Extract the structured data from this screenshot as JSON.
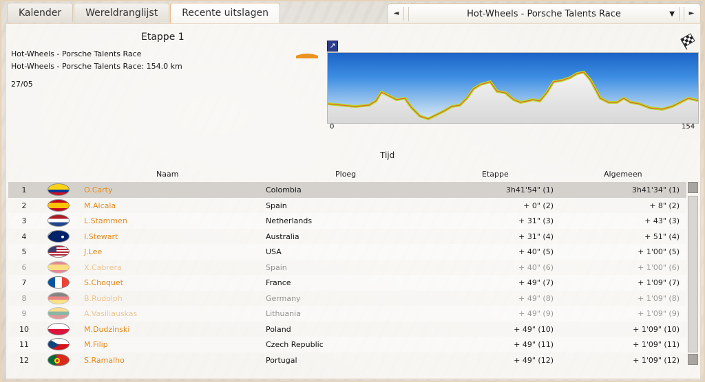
{
  "tabs": [
    {
      "label": "Kalender"
    },
    {
      "label": "Wereldranglijst"
    },
    {
      "label": "Recente uitslagen"
    }
  ],
  "race_selector": {
    "selected": "Hot-Wheels - Porsche Talents Race",
    "prev_icon": "triangle-left-icon",
    "next_icon": "triangle-right-icon",
    "dropdown_icon": "caret-down-icon"
  },
  "stage": {
    "title": "Etappe 1",
    "race_name": "Hot-Wheels - Porsche Talents Race",
    "race_distance": "Hot-Wheels - Porsche Talents Race: 154.0 km",
    "date": "27/05",
    "profile_start_km": "0",
    "profile_end_km": "154"
  },
  "section_label": "Tijd",
  "columns": {
    "name": "Naam",
    "team": "Ploeg",
    "stage": "Etappe",
    "general": "Algemeen"
  },
  "colors": {
    "accent": "#e38a1c",
    "profile_sky_top": "#1b63c6",
    "profile_ground": "#e6e6e6"
  },
  "results": [
    {
      "pos": "1",
      "flag": "colombia",
      "name": "O.Carty",
      "team": "Colombia",
      "stage": "3h41'54\" (1)",
      "general": "3h41'34\" (1)"
    },
    {
      "pos": "2",
      "flag": "spain",
      "name": "M.Alcala",
      "team": "Spain",
      "stage": "+ 0\" (2)",
      "general": "+ 8\" (2)"
    },
    {
      "pos": "3",
      "flag": "netherlands",
      "name": "L.Stammen",
      "team": "Netherlands",
      "stage": "+ 31\" (3)",
      "general": "+ 43\" (3)"
    },
    {
      "pos": "4",
      "flag": "australia",
      "name": "I.Stewart",
      "team": "Australia",
      "stage": "+ 31\" (4)",
      "general": "+ 51\" (4)"
    },
    {
      "pos": "5",
      "flag": "usa",
      "name": "J.Lee",
      "team": "USA",
      "stage": "+ 40\" (5)",
      "general": "+ 1'00\" (5)"
    },
    {
      "pos": "6",
      "flag": "spain",
      "name": "X.Cabrera",
      "team": "Spain",
      "stage": "+ 40\" (6)",
      "general": "+ 1'00\" (6)"
    },
    {
      "pos": "7",
      "flag": "france",
      "name": "S.Choquet",
      "team": "France",
      "stage": "+ 49\" (7)",
      "general": "+ 1'09\" (7)"
    },
    {
      "pos": "8",
      "flag": "germany",
      "name": "B.Rudolph",
      "team": "Germany",
      "stage": "+ 49\" (8)",
      "general": "+ 1'09\" (8)"
    },
    {
      "pos": "9",
      "flag": "lithuania",
      "name": "A.Vasiliauskas",
      "team": "Lithuania",
      "stage": "+ 49\" (9)",
      "general": "+ 1'09\" (9)"
    },
    {
      "pos": "10",
      "flag": "poland",
      "name": "M.Dudzinski",
      "team": "Poland",
      "stage": "+ 49\" (10)",
      "general": "+ 1'09\" (10)"
    },
    {
      "pos": "11",
      "flag": "czech",
      "name": "M.Filip",
      "team": "Czech Republic",
      "stage": "+ 49\" (11)",
      "general": "+ 1'09\" (11)"
    },
    {
      "pos": "12",
      "flag": "portugal",
      "name": "S.Ramalho",
      "team": "Portugal",
      "stage": "+ 49\" (12)",
      "general": "+ 1'09\" (12)"
    }
  ]
}
